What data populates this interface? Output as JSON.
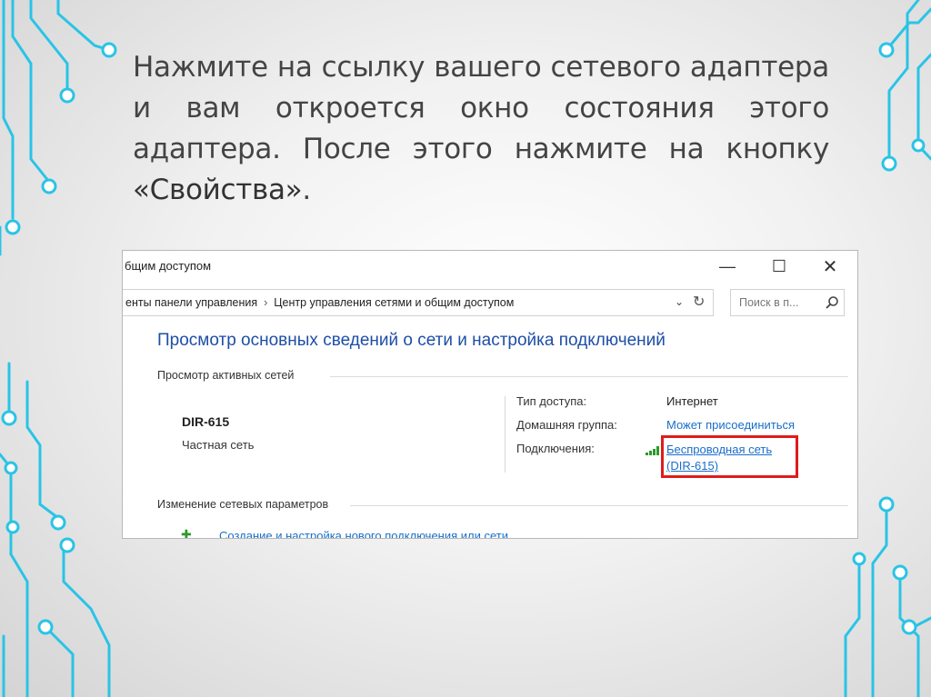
{
  "slide": {
    "text_main": "Нажмите на ссылку вашего сетевого адаптера и вам откроется окно состояния этого адаптера. После этого нажмите на кнопку ",
    "text_em": "«Свойства»",
    "text_end": "."
  },
  "window": {
    "title": "бщим доступом",
    "minimize_glyph": "—",
    "maximize_glyph": "☐",
    "close_glyph": "✕"
  },
  "address": {
    "crumb1": "енты панели управления",
    "separator": "›",
    "crumb2": "Центр управления сетями и общим доступом",
    "dropdown_glyph": "⌄",
    "refresh_glyph": "↻"
  },
  "search": {
    "placeholder": "Поиск в п..."
  },
  "main": {
    "heading": "Просмотр основных сведений о сети и настройка подключений",
    "active_networks_label": "Просмотр активных сетей",
    "network": {
      "name": "DIR-615",
      "type": "Частная сеть"
    },
    "props": {
      "access_type_label": "Тип доступа:",
      "access_type_value": "Интернет",
      "homegroup_label": "Домашняя группа:",
      "homegroup_value": "Может присоединиться",
      "connections_label": "Подключения:",
      "connection_line1": "Беспроводная сеть",
      "connection_line2": "(DIR-615)"
    },
    "change_settings_label": "Изменение сетевых параметров",
    "bottom_link": "Создание и настройка нового подключения или сети",
    "bottom_icon_glyph": "✚"
  },
  "colors": {
    "heading_blue": "#1e4ea6",
    "link_blue": "#1a6ec9",
    "highlight_red": "#e01b1b",
    "deco_cyan": "#29c4e6"
  },
  "icons": {
    "search": "search-icon",
    "signal": "wifi-signal-icon",
    "decoration": "circuit-decoration"
  }
}
